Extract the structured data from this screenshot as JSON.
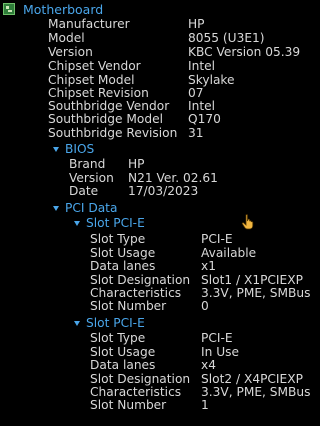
{
  "motherboard": {
    "title": "Motherboard",
    "icon": "motherboard-icon",
    "fields": [
      {
        "label": "Manufacturer",
        "value": "HP"
      },
      {
        "label": "Model",
        "value": "8055 (U3E1)"
      },
      {
        "label": "Version",
        "value": "KBC Version 05.39"
      },
      {
        "label": "Chipset Vendor",
        "value": "Intel"
      },
      {
        "label": "Chipset Model",
        "value": "Skylake"
      },
      {
        "label": "Chipset Revision",
        "value": "07"
      },
      {
        "label": "Southbridge Vendor",
        "value": "Intel"
      },
      {
        "label": "Southbridge Model",
        "value": "Q170"
      },
      {
        "label": "Southbridge Revision",
        "value": "31"
      }
    ]
  },
  "bios": {
    "title": "BIOS",
    "fields": [
      {
        "label": "Brand",
        "value": "HP"
      },
      {
        "label": "Version",
        "value": "N21 Ver. 02.61"
      },
      {
        "label": "Date",
        "value": "17/03/2023"
      }
    ]
  },
  "pci": {
    "title": "PCI Data",
    "slots": [
      {
        "title": "Slot PCI-E",
        "fields": [
          {
            "label": "Slot Type",
            "value": "PCI-E"
          },
          {
            "label": "Slot Usage",
            "value": "Available"
          },
          {
            "label": "Data lanes",
            "value": "x1"
          },
          {
            "label": "Slot Designation",
            "value": "Slot1 / X1PCIEXP"
          },
          {
            "label": "Characteristics",
            "value": "3.3V, PME, SMBus"
          },
          {
            "label": "Slot Number",
            "value": "0"
          }
        ]
      },
      {
        "title": "Slot PCI-E",
        "fields": [
          {
            "label": "Slot Type",
            "value": "PCI-E"
          },
          {
            "label": "Slot Usage",
            "value": "In Use"
          },
          {
            "label": "Data lanes",
            "value": "x4"
          },
          {
            "label": "Slot Designation",
            "value": "Slot2 / X4PCIEXP"
          },
          {
            "label": "Characteristics",
            "value": "3.3V, PME, SMBus"
          },
          {
            "label": "Slot Number",
            "value": "1"
          }
        ]
      }
    ]
  },
  "colors": {
    "background": "#000000",
    "text": "#d8d8d8",
    "accent": "#4aa6ea"
  }
}
